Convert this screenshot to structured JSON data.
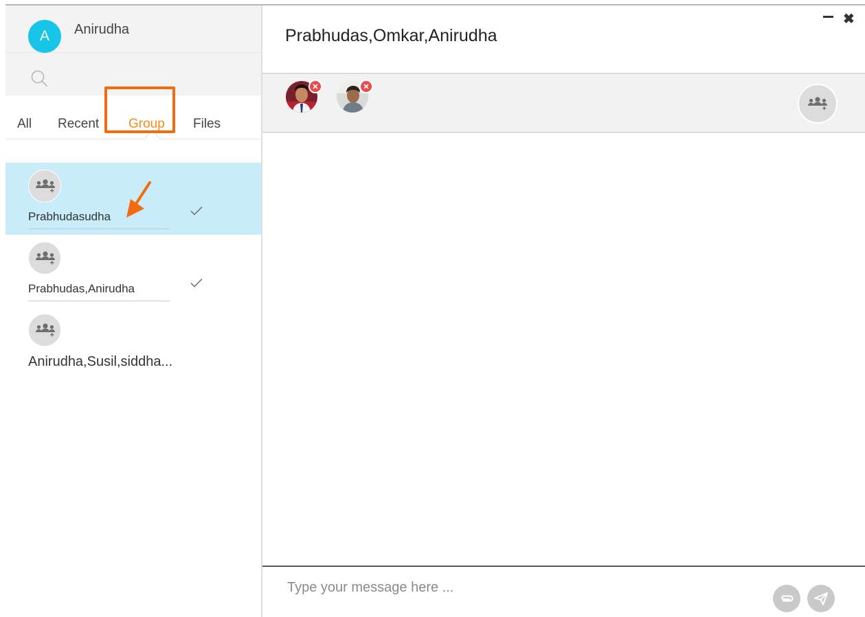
{
  "user": {
    "initial": "A",
    "name": "Anirudha"
  },
  "search": {
    "icon": "search-icon"
  },
  "tabs": [
    {
      "label": "All",
      "active": false
    },
    {
      "label": "Recent",
      "active": false
    },
    {
      "label": "Group",
      "active": true
    },
    {
      "label": "Files",
      "active": false
    }
  ],
  "conversations": [
    {
      "name": "Prabhudasudha",
      "selected": true,
      "read": true,
      "icon": "group-icon"
    },
    {
      "name": "Prabhudas,Anirudha",
      "selected": false,
      "read": true,
      "icon": "group-icon"
    },
    {
      "name": "Anirudha,Susil,siddha...",
      "selected": false,
      "read": false,
      "icon": "group-icon"
    }
  ],
  "chat": {
    "title": "Prabhudas,Omkar,Anirudha",
    "members": [
      {
        "icon": "member-avatar",
        "remove_icon": "remove-icon"
      },
      {
        "icon": "member-avatar",
        "remove_icon": "remove-icon"
      }
    ],
    "add_member_icon": "add-group-member-icon"
  },
  "composer": {
    "placeholder": "Type your message here ...",
    "attach_icon": "paperclip-icon",
    "send_icon": "send-icon"
  },
  "window_controls": {
    "minimize_icon": "minimize-icon",
    "close_icon": "close-icon"
  },
  "colors": {
    "accent": "#f98a14",
    "annotation": "#f26b10",
    "avatar": "#17c5e8",
    "selected_row": "#c9ecfa",
    "remove_badge": "#e84b4b"
  }
}
